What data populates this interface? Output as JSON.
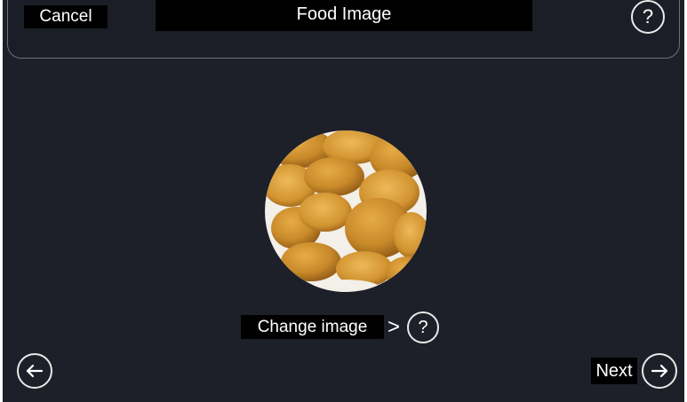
{
  "header": {
    "cancel_label": "Cancel",
    "title": "Food Image",
    "help_icon_glyph": "?"
  },
  "main": {
    "image_icon": "food-image",
    "change_image_label": "Change image",
    "chevron_glyph": ">",
    "help_icon_glyph": "?"
  },
  "footer": {
    "back_icon": "arrow-left-icon",
    "next_label": "Next",
    "next_icon": "arrow-right-icon"
  },
  "colors": {
    "background": "#1d2028",
    "label_background": "#000000",
    "text": "#ffffff",
    "outline": "#e8e8e8"
  }
}
